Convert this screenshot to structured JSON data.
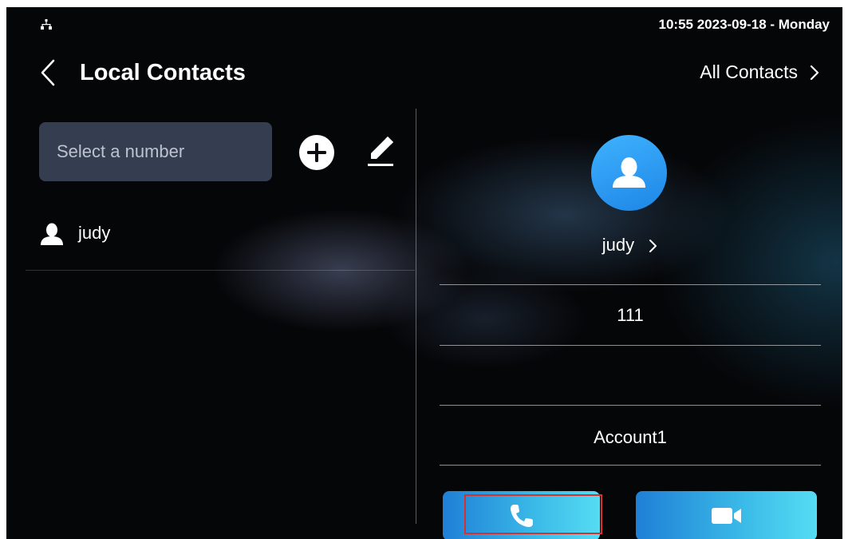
{
  "status_bar": {
    "network_icon": "network-icon",
    "clock": "10:55  2023-09-18 - Monday"
  },
  "header": {
    "back_icon": "chevron-left-icon",
    "title": "Local Contacts",
    "all_contacts_label": "All Contacts",
    "all_contacts_icon": "chevron-right-icon"
  },
  "toolbar": {
    "search_placeholder": "Select a number",
    "search_value": "",
    "add_icon": "plus-circle-icon",
    "edit_icon": "pencil-icon"
  },
  "contacts": [
    {
      "name": "judy",
      "icon": "person-icon"
    }
  ],
  "detail": {
    "avatar_icon": "person-icon",
    "name": "judy",
    "name_chevron": "chevron-right-icon",
    "number": "111",
    "empty_field": "",
    "account": "Account1"
  },
  "actions": {
    "call_icon": "phone-icon",
    "video_icon": "video-camera-icon",
    "highlight_color": "#d8302a"
  },
  "colors": {
    "accent_blue": "#2b8ee8",
    "button_gradient_start": "#1f7fd6",
    "button_gradient_end": "#55dcf3"
  }
}
